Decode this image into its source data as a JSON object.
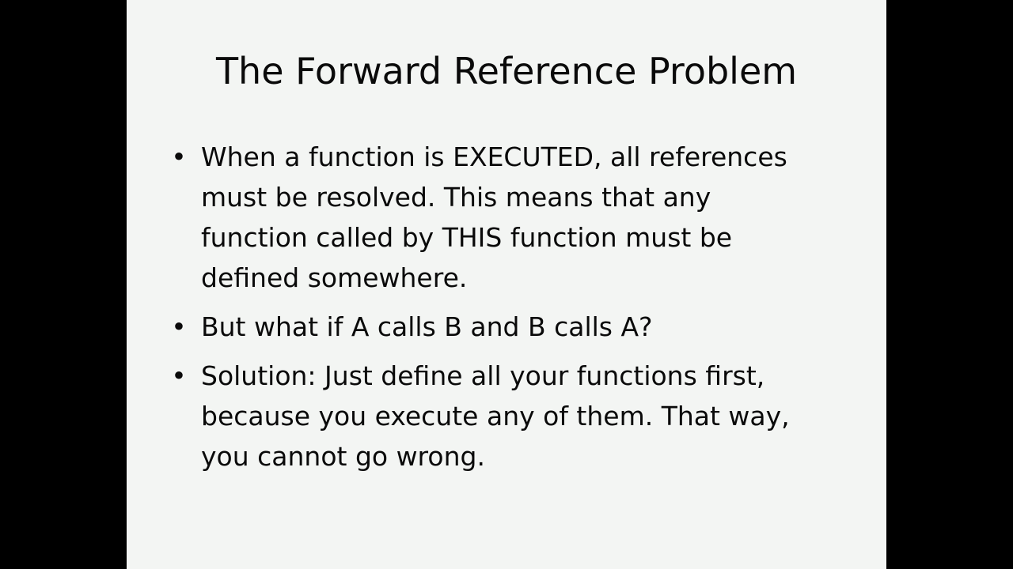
{
  "slide": {
    "title": "The Forward Reference Problem",
    "bullet_symbol": "•",
    "bullets": [
      {
        "lines": [
          "When a function is EXECUTED, all references",
          "must be resolved. This means that any",
          "function called by THIS function must be",
          "defined somewhere."
        ]
      },
      {
        "lines": [
          "But what if A calls B and B calls A?"
        ]
      },
      {
        "lines": [
          "Solution: Just define all your functions first,",
          "because you execute any of them. That way,",
          "you cannot go wrong."
        ]
      }
    ]
  },
  "colors": {
    "letterbox": "#000000",
    "slide_background": "#f3f5f3",
    "text": "#0a0a0a"
  }
}
